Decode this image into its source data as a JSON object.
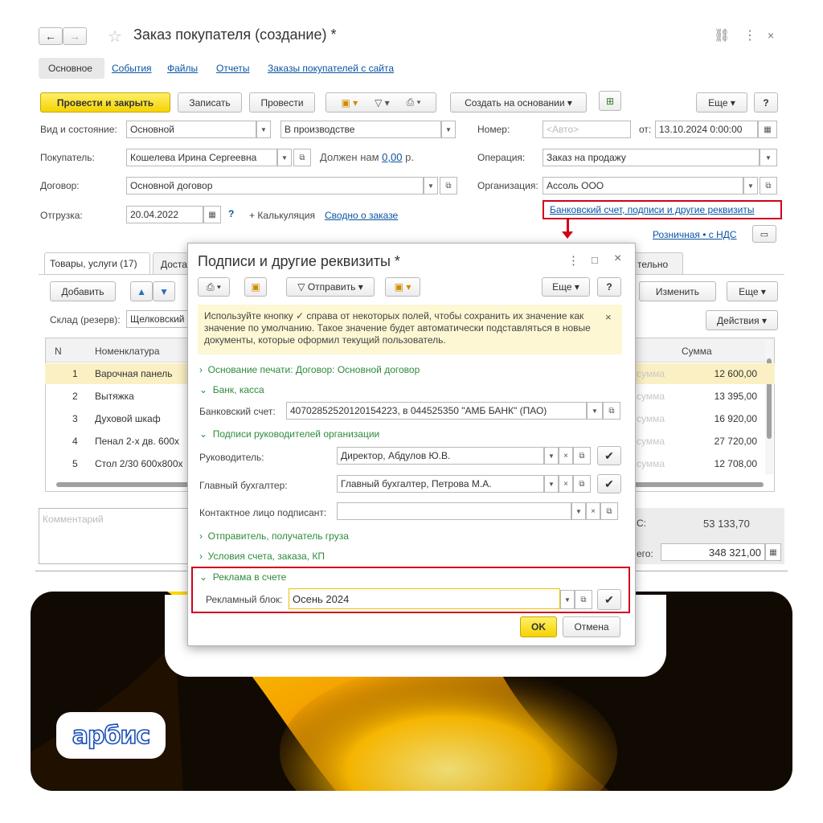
{
  "window": {
    "title": "Заказ покупателя (создание) *"
  },
  "tabs": [
    "Основное",
    "События",
    "Файлы",
    "Отчеты",
    "Заказы покупателей с сайта"
  ],
  "toolbar": {
    "post_close": "Провести и закрыть",
    "save": "Записать",
    "post": "Провести",
    "create_based": "Создать на основании",
    "more": "Еще",
    "help": "?"
  },
  "form": {
    "kind_label": "Вид и состояние:",
    "kind": "Основной",
    "state": "В производстве",
    "number_label": "Номер:",
    "number_placeholder": "<Авто>",
    "date_label": "от:",
    "date": "13.10.2024  0:00:00",
    "buyer_label": "Покупатель:",
    "buyer": "Кошелева Ирина Сергеевна",
    "owes": "Должен нам",
    "owes_amount": "0,00",
    "owes_unit": "р.",
    "operation_label": "Операция:",
    "operation": "Заказ на продажу",
    "contract_label": "Договор:",
    "contract": "Основной договор",
    "org_label": "Организация:",
    "org": "Ассоль ООО",
    "shipment_label": "Отгрузка:",
    "shipment": "20.04.2022",
    "calc": "+ Калькуляция",
    "summary": "Сводно о заказе",
    "bank_link": "Банковский счет, подписи и другие реквизиты",
    "price_type": "Розничная • с НДС"
  },
  "items_tab": {
    "tab_label": "Товары, услуги (17)",
    "tab2_label": "Доста",
    "tab_right": "тельно",
    "add": "Добавить",
    "edit": "Изменить",
    "more": "Еще",
    "actions": "Действия",
    "warehouse_label": "Склад (резерв):",
    "warehouse": "Щелковский",
    "columns": {
      "n": "N",
      "nom": "Номенклатура",
      "sum": "Сумма"
    },
    "rows": [
      {
        "n": "1",
        "name": "Варочная панель",
        "sum": "12 600,00"
      },
      {
        "n": "2",
        "name": "Вытяжка",
        "sum": "13 395,00"
      },
      {
        "n": "3",
        "name": "Духовой шкаф",
        "sum": "16 920,00"
      },
      {
        "n": "4",
        "name": "Пенал 2-х дв. 600х",
        "sum": "27 720,00"
      },
      {
        "n": "5",
        "name": "Стол 2/30 600х800х",
        "sum": "12 708,00"
      }
    ],
    "sum_word": "сумма",
    "comment_placeholder": "Комментарий",
    "vat_label": "С:",
    "vat_value": "53 133,70",
    "total_label": "его:",
    "total_value": "348 321,00"
  },
  "dialog": {
    "title": "Подписи и другие реквизиты *",
    "send": "Отправить",
    "more": "Еще",
    "help": "?",
    "hint": "Используйте кнопку ✓ справа от некоторых полей, чтобы сохранить их значение как значение по умолчанию. Такое значение будет автоматически подставляться в новые документы, которые оформил текущий пользователь.",
    "sec_print": "Основание печати: Договор: Основной договор",
    "sec_bank": "Банк, касса",
    "bank_label": "Банковский счет:",
    "bank": "40702852520120154223, в 044525350 \"АМБ БАНК\" (ПАО)",
    "sec_sign": "Подписи руководителей организации",
    "head_label": "Руководитель:",
    "head": "Директор, Абдулов Ю.В.",
    "acc_label": "Главный бухгалтер:",
    "acc": "Главный бухгалтер, Петрова М.А.",
    "contact_label": "Контактное лицо подписант:",
    "sec_cargo": "Отправитель, получатель груза",
    "sec_terms": "Условия счета, заказа, КП",
    "sec_ad": "Реклама в счете",
    "ad_label": "Рекламный блок:",
    "ad": "Осень 2024",
    "ok": "OK",
    "cancel": "Отмена"
  },
  "logo": {
    "text": "арбис"
  },
  "colors": {
    "accent_yellow": "#f4d300",
    "link": "#0a55a3",
    "section_green": "#2e8b3a",
    "highlight_red": "#d0021b"
  }
}
